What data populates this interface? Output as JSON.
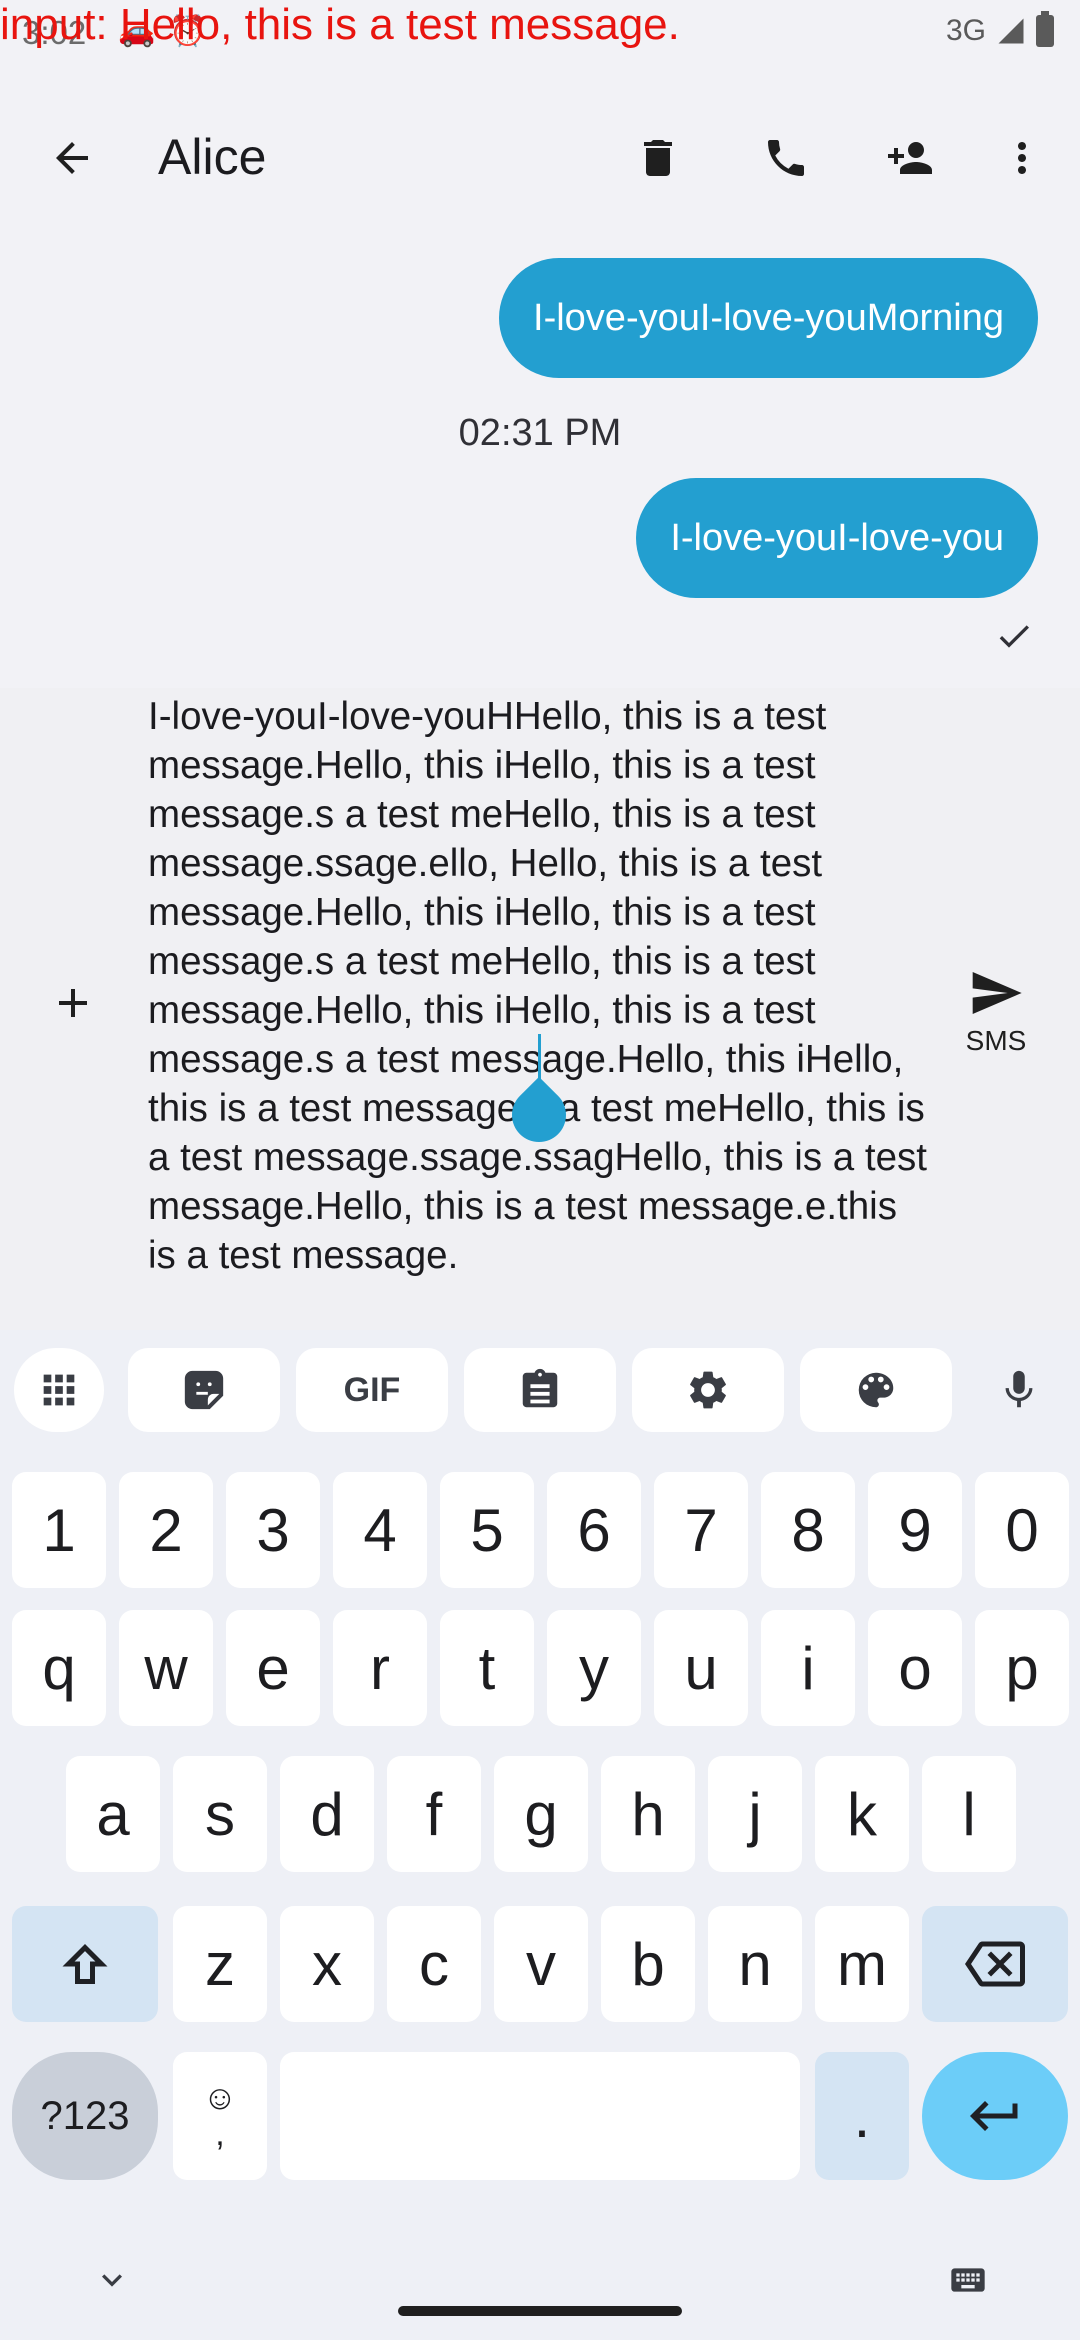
{
  "status_bar": {
    "time": "3:02",
    "network": "3G",
    "overlay_text": "input: Hello, this is a test message."
  },
  "app_bar": {
    "title": "Alice",
    "icons": [
      "back-arrow-icon",
      "delete-icon",
      "phone-icon",
      "add-contact-icon",
      "more-vert-icon"
    ]
  },
  "conversation": {
    "messages": [
      {
        "text": "I-love-youI-love-youMorning"
      },
      {
        "timestamp": "02:31 PM"
      },
      {
        "text": "I-love-youI-love-you"
      }
    ]
  },
  "compose": {
    "text": "I-love-youI-love-youHHello, this is a test message.Hello, this iHello, this is a test message.s a test meHello, this is a test message.ssage.ello, Hello, this is a test message.Hello, this iHello, this is a test message.s a test meHello, this is a test message.Hello, this iHello, this is a test message.s a test message.Hello, this iHello, this is a test message.s a test meHello, this is a test message.ssage.ssagHello, this is a test message.Hello, this is a test message.e.this is a test message.",
    "send_label": "SMS"
  },
  "keyboard": {
    "toolbar": [
      "apps-grid-icon",
      "sticker-icon",
      "GIF",
      "clipboard-icon",
      "settings-gear-icon",
      "palette-icon",
      "microphone-icon"
    ],
    "gif_label": "GIF",
    "row_numbers": [
      "1",
      "2",
      "3",
      "4",
      "5",
      "6",
      "7",
      "8",
      "9",
      "0"
    ],
    "row1": [
      "q",
      "w",
      "e",
      "r",
      "t",
      "y",
      "u",
      "i",
      "o",
      "p"
    ],
    "row2": [
      "a",
      "s",
      "d",
      "f",
      "g",
      "h",
      "j",
      "k",
      "l"
    ],
    "row3": [
      "z",
      "x",
      "c",
      "v",
      "b",
      "n",
      "m"
    ],
    "symbols_label": "?123",
    "emoji_top": "☺",
    "comma_label": ",",
    "period_label": "."
  },
  "colors": {
    "bubble": "#239fd0",
    "enter_key": "#6ccdf8",
    "overlay": "#e8140f"
  }
}
